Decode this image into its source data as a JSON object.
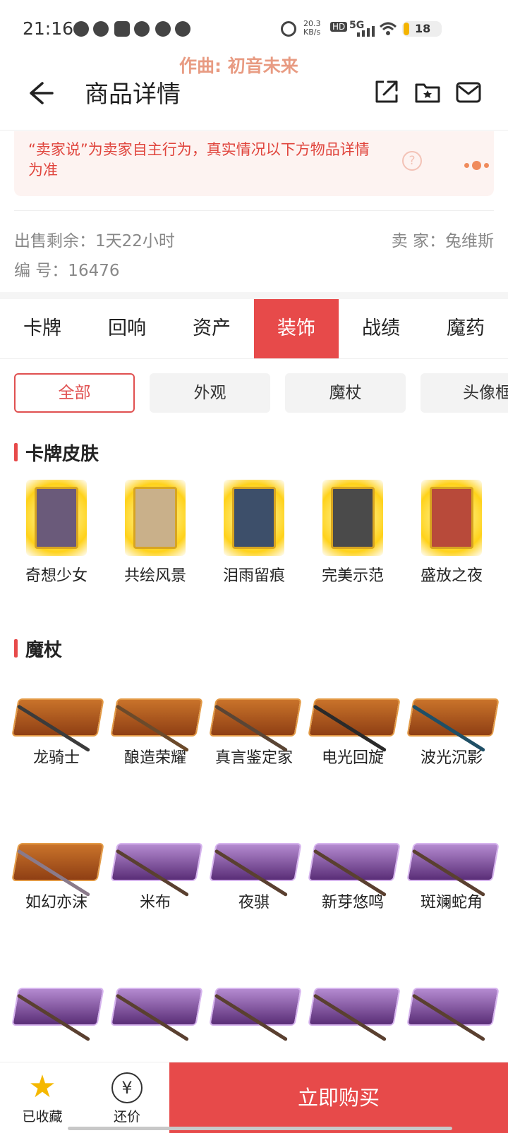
{
  "status_bar": {
    "time": "21:16",
    "net_speed": "20.3 KB/s",
    "hd": "HD",
    "signal": "5G",
    "battery": "18"
  },
  "watermark": "作曲: 初音未来",
  "header": {
    "title": "商品详情",
    "back_icon": "arrow-left-icon",
    "share_icon": "share-icon",
    "favorite_folder_icon": "folder-star-icon",
    "mail_icon": "mail-icon"
  },
  "notice": {
    "text": "“卖家说”为卖家自主行为，真实情况以下方物品详情为准"
  },
  "info": {
    "remaining_label": "出售剩余：1天22小时",
    "seller_label": "卖  家：兔维斯",
    "id_label": "编  号：16476"
  },
  "tabs": [
    {
      "label": "卡牌"
    },
    {
      "label": "回响"
    },
    {
      "label": "资产"
    },
    {
      "label": "装饰",
      "active": true
    },
    {
      "label": "战绩"
    },
    {
      "label": "魔药"
    }
  ],
  "filters": [
    {
      "label": "全部",
      "active": true
    },
    {
      "label": "外观"
    },
    {
      "label": "魔杖"
    },
    {
      "label": "头像框"
    }
  ],
  "sections": {
    "card_skins": {
      "title": "卡牌皮肤",
      "items": [
        "奇想少女",
        "共绘风景",
        "泪雨留痕",
        "完美示范",
        "盛放之夜"
      ]
    },
    "wands": {
      "title": "魔杖",
      "items": [
        "龙骑士",
        "酿造荣耀",
        "真言鉴定家",
        "电光回旋",
        "波光沉影",
        "如幻亦沫",
        "米布",
        "夜骐",
        "新芽悠鸣",
        "斑斓蛇角"
      ]
    }
  },
  "bottom_bar": {
    "favorited_label": "已收藏",
    "bargain_label": "还价",
    "buy_label": "立即购买",
    "yuan_symbol": "¥",
    "star_symbol": "★"
  },
  "colors": {
    "accent": "#e74a4a",
    "notice_bg": "#fdf3f1",
    "star": "#f5b800"
  }
}
